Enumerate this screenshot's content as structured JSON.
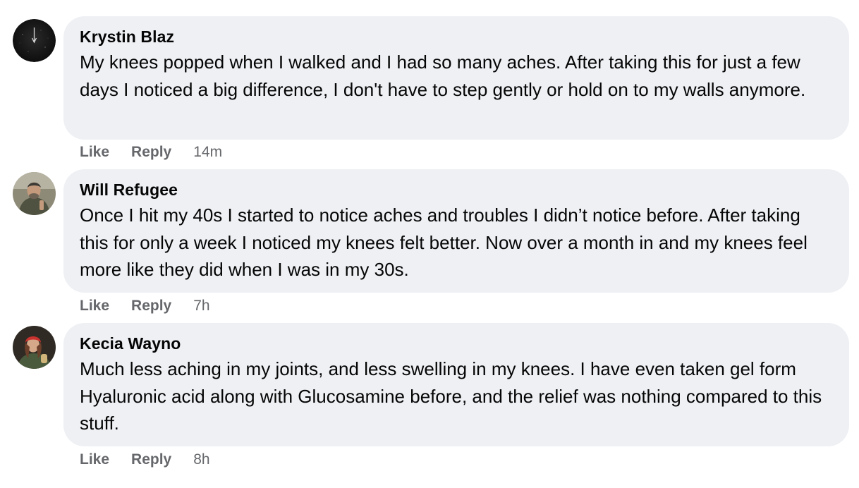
{
  "comments": [
    {
      "author": "Krystin Blaz",
      "text": "My knees popped when I walked and I had so many aches. After taking this for just a few days I noticed a big difference, I don't have to step gently or hold on to my walls anymore.",
      "like_label": "Like",
      "reply_label": "Reply",
      "time": "14m"
    },
    {
      "author": "Will Refugee",
      "text": "Once I hit my 40s I started to notice aches and troubles I didn’t notice before. After taking this for only a week I noticed my knees felt better. Now over a month in and my knees feel more like they did when I was in my 30s.",
      "like_label": "Like",
      "reply_label": "Reply",
      "time": "7h"
    },
    {
      "author": "Kecia Wayno",
      "text": "Much less aching in my joints, and less swelling in my knees. I have even taken gel form Hyaluronic acid along with Glucosamine before, and the relief was nothing compared to this stuff.",
      "like_label": "Like",
      "reply_label": "Reply",
      "time": "8h"
    }
  ],
  "colors": {
    "bubble": "#eef0f4",
    "meta_text": "#65676b",
    "body_text": "#050505"
  }
}
